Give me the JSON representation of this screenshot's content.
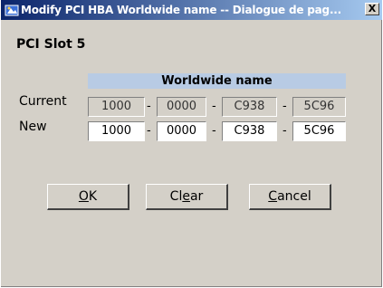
{
  "window": {
    "title": "Modify PCI HBA Worldwide name -- Dialogue de pag...",
    "close_label": "X"
  },
  "slot": {
    "label": "PCI Slot 5"
  },
  "table": {
    "header": "Worldwide name",
    "separator": "-",
    "rows": [
      {
        "label": "Current",
        "fields": [
          "1000",
          "0000",
          "C938",
          "5C96"
        ]
      },
      {
        "label": "New",
        "fields": [
          "1000",
          "0000",
          "C938",
          "5C96"
        ]
      }
    ]
  },
  "buttons": {
    "ok_label": "OK",
    "clear_label": "Clear",
    "cancel_label": "Cancel"
  },
  "icons": {
    "title_icon": "app-icon",
    "close_icon": "close-icon"
  }
}
